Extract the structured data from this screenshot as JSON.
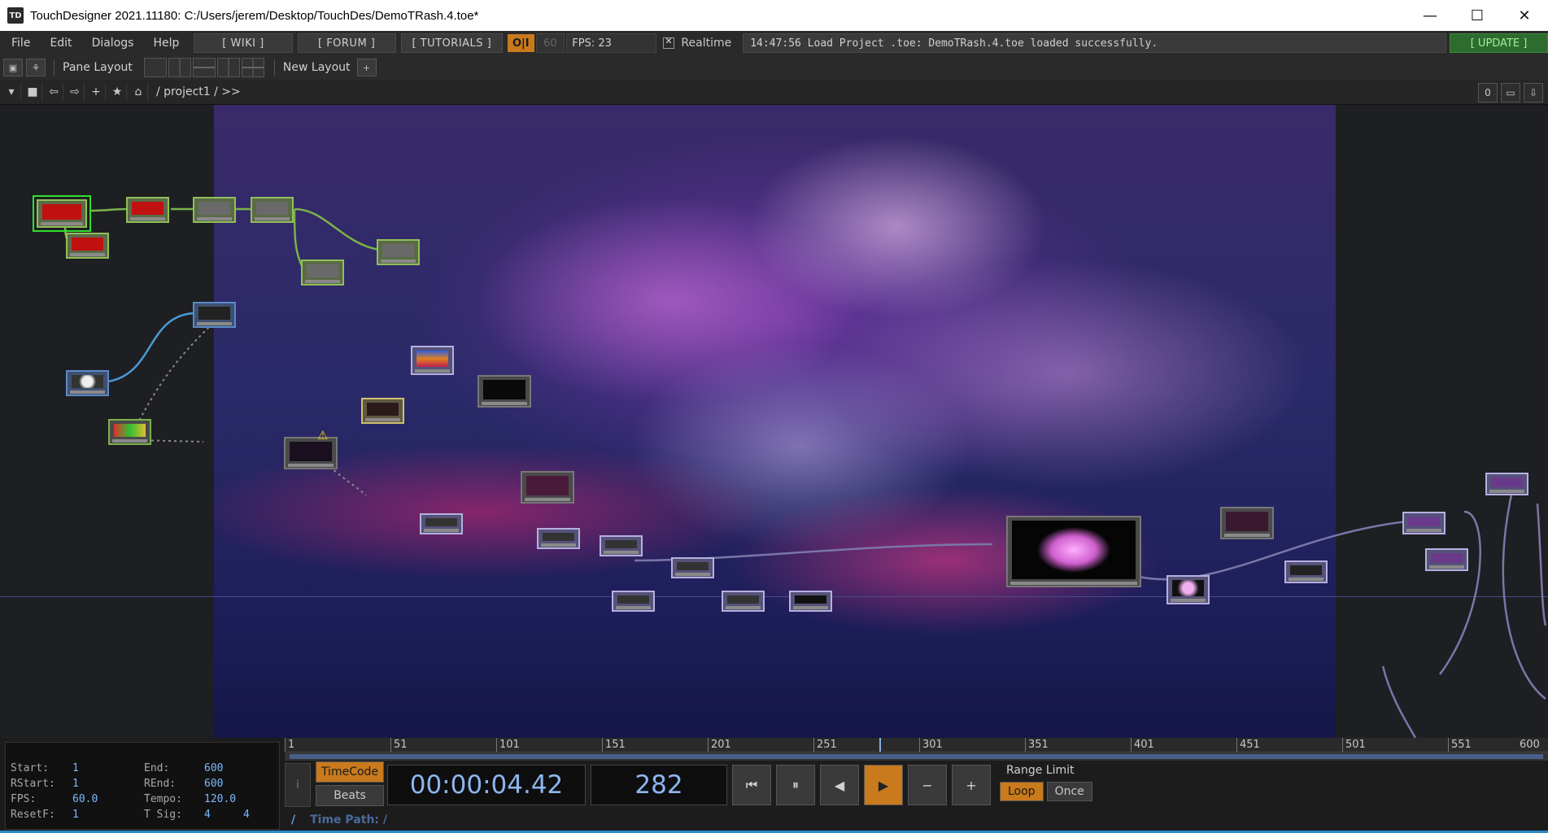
{
  "window": {
    "title": "TouchDesigner 2021.11180: C:/Users/jerem/Desktop/TouchDes/DemoTRash.4.toe*",
    "app_icon_text": "TD",
    "controls": {
      "minimize": "—",
      "maximize": "☐",
      "close": "✕"
    }
  },
  "menubar": {
    "menus": [
      "File",
      "Edit",
      "Dialogs",
      "Help"
    ],
    "wiki": "[ WIKI ]",
    "forum": "[ FORUM ]",
    "tutorials": "[ TUTORIALS ]",
    "oi": "O|I",
    "fps_cap": "60",
    "fps_display": "FPS:  23",
    "realtime": "Realtime",
    "status": "14:47:56 Load Project .toe: DemoTRash.4.toe loaded successfully.",
    "update": "[ UPDATE ]"
  },
  "panebar": {
    "pane_layout": "Pane Layout",
    "new_layout": "New Layout",
    "add": "+"
  },
  "pathbar": {
    "path": "/ project1 / >>",
    "right_count": "0"
  },
  "timeline": {
    "ruler_ticks": [
      "1",
      "51",
      "101",
      "151",
      "201",
      "251",
      "301",
      "351",
      "401",
      "451",
      "501",
      "551",
      "600"
    ],
    "current_frame_marker": 282,
    "ranges": {
      "start_label": "Start:",
      "start": "1",
      "end_label": "End:",
      "end": "600",
      "rstart_label": "RStart:",
      "rstart": "1",
      "rend_label": "REnd:",
      "rend": "600",
      "fps_label": "FPS:",
      "fps": "60.0",
      "tempo_label": "Tempo:",
      "tempo": "120.0",
      "resetf_label": "ResetF:",
      "resetf": "1",
      "tsig_label": "T Sig:",
      "tsig_a": "4",
      "tsig_b": "4"
    },
    "info_btn": "i",
    "timecode_btn": "TimeCode",
    "beats_btn": "Beats",
    "timecode": "00:00:04.42",
    "frame": "282",
    "transport": {
      "rewind": "⏮",
      "pause": "⏸",
      "step_back": "◀",
      "play": "▶",
      "minus": "−",
      "plus": "+"
    },
    "range_limit": "Range Limit",
    "loop": "Loop",
    "once": "Once",
    "time_path_slash": "/",
    "time_path": "Time Path: /"
  },
  "colors": {
    "accent_orange": "#c87a1c",
    "timecode_blue": "#8cb6f0",
    "update_green": "#2e6b2e",
    "selection_green": "#2ee02e"
  }
}
